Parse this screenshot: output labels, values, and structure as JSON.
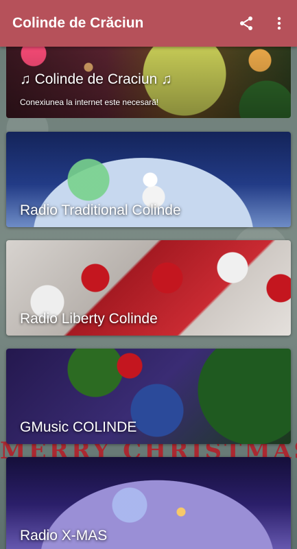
{
  "appbar": {
    "title": "Colinde de Crăciun",
    "share_icon": "share-icon",
    "more_icon": "more-vertical-icon"
  },
  "banner": {
    "title": "♫  Colinde de Craciun ♫",
    "subtitle": "Conexiunea la internet este necesară!"
  },
  "background_text": "MERRY CHRISTMAS",
  "stations": [
    {
      "name": "Radio Traditional Colinde"
    },
    {
      "name": "Radio Liberty Colinde"
    },
    {
      "name": "GMusic COLINDE"
    },
    {
      "name": "Radio X-MAS"
    }
  ],
  "colors": {
    "appbar": "#b6515a",
    "text": "#ffffff",
    "background_text": "#b3202a"
  }
}
